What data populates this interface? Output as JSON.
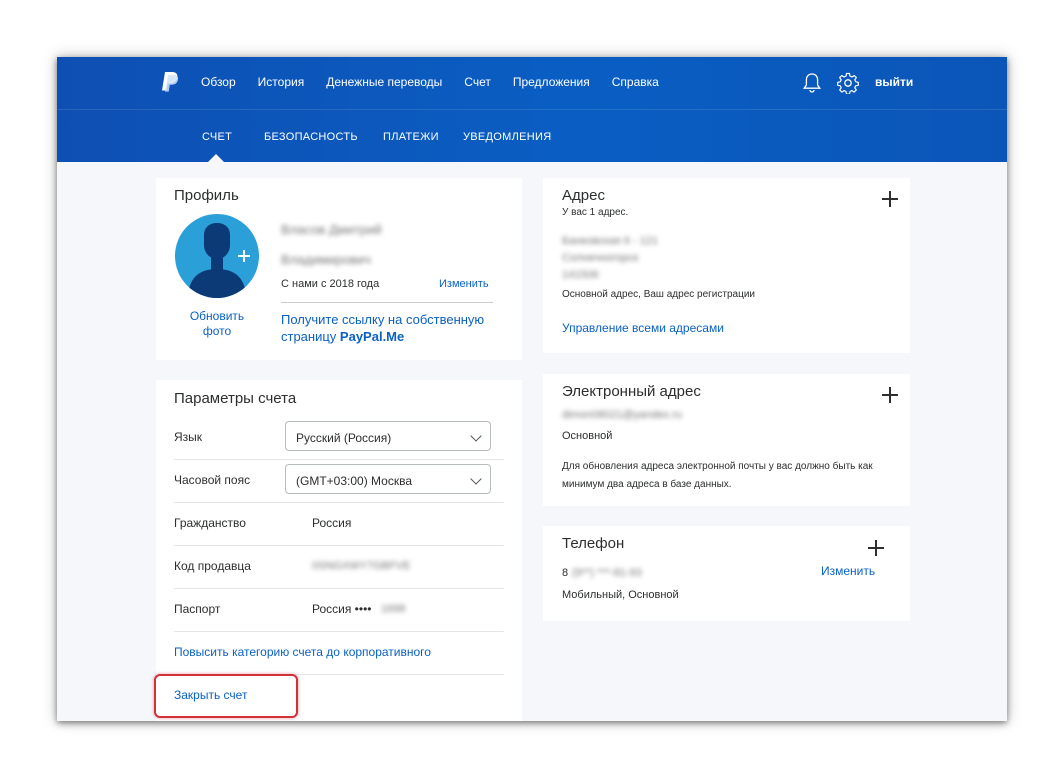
{
  "nav": {
    "links": [
      "Обзор",
      "История",
      "Денежные переводы",
      "Счет",
      "Предложения",
      "Справка"
    ],
    "logout": "выйти"
  },
  "subnav": {
    "tabs": [
      "СЧЕТ",
      "БЕЗОПАСНОСТЬ",
      "ПЛАТЕЖИ",
      "УВЕДОМЛЕНИЯ"
    ],
    "active": "СЧЕТ"
  },
  "profile": {
    "title": "Профиль",
    "name_line1": "Власов Дмитрий",
    "name_line2": "Владимирович",
    "member_since": "С нами с 2018 года",
    "edit": "Изменить",
    "update_photo_1": "Обновить",
    "update_photo_2": "фото",
    "paypalme_1": "Получите ссылку на собственную",
    "paypalme_2": "страницу ",
    "paypalme_brand": "PayPal.Me"
  },
  "settings": {
    "title": "Параметры счета",
    "language_label": "Язык",
    "language_value": "Русский (Россия)",
    "timezone_label": "Часовой пояс",
    "timezone_value": "(GMT+03:00) Москва",
    "citizenship_label": "Гражданство",
    "citizenship_value": "Россия",
    "merchant_label": "Код продавца",
    "merchant_value": "0SNGXWY7GBFVE",
    "passport_label": "Паспорт",
    "passport_value": "Россия ••••",
    "passport_hidden": "1698",
    "upgrade_link": "Повысить категорию счета до корпоративного",
    "close_link": "Закрыть счет"
  },
  "address": {
    "title": "Адрес",
    "count": "У вас 1 адрес.",
    "line1": "Банковская 6 - 121",
    "line2": "Солнечногорск",
    "line3": "141506",
    "note": "Основной адрес, Ваш адрес регистрации",
    "manage": "Управление всеми адресами"
  },
  "email": {
    "title": "Электронный адрес",
    "value": "dimon08021@yandex.ru",
    "status": "Основной",
    "note_1": "Для обновления адреса электронной почты у вас должно быть как",
    "note_2": "минимум два адреса в базе данных."
  },
  "phone": {
    "title": "Телефон",
    "prefix": "8",
    "value": "(9**) ***-81-93",
    "edit": "Изменить",
    "status": "Мобильный, Основной"
  },
  "colors": {
    "brand_blue": "#0b57bd",
    "link": "#0a61c2",
    "avatar": "#2a9fd8",
    "highlight_red": "#d0313a"
  }
}
